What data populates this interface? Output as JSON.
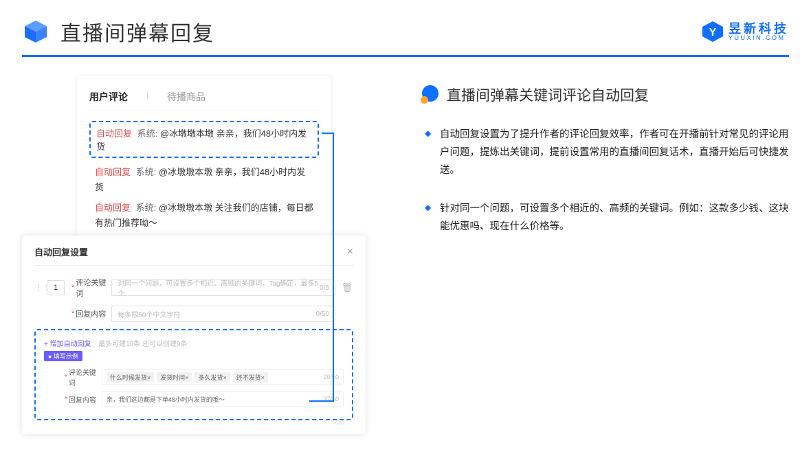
{
  "header": {
    "title": "直播间弹幕回复",
    "logo_cn": "昱新科技",
    "logo_en": "YUUXIN.COM"
  },
  "right": {
    "heading": "直播间弹幕关键词评论自动回复",
    "bullet1": "自动回复设置为了提升作者的评论回复效率，作者可在开播前针对常见的评论用户问题，提炼出关键词，提前设置常用的直播间回复话术，直播开始后可快捷发送。",
    "bullet2": "针对同一个问题，可设置多个相近的、高频的关键词。例如：这款多少钱、这块能优惠吗、现在什么价格等。"
  },
  "comments": {
    "tab1": "用户评论",
    "tab2": "待播商品",
    "auto_label": "自动回复",
    "sys_label": "系统:",
    "row1": "@冰墩墩本墩 亲亲，我们48小时内发货",
    "row2": "@冰墩墩本墩 亲亲，我们48小时内发货",
    "row3": "@冰墩墩本墩 关注我们的店铺，每日都有热门推荐呦～"
  },
  "settings": {
    "title": "自动回复设置",
    "num": "1",
    "label_kw": "评论关键词",
    "placeholder_kw": "对同一个问题，可设置多个相近、高频的关键词，Tag确定，最多5个",
    "count_kw": "0/5",
    "label_reply": "回复内容",
    "placeholder_reply": "每条限50个中文字符",
    "count_reply": "0/50",
    "add_link": "+ 增加自动回复",
    "add_note": "最多可建10条 还可以创建9条",
    "example_badge": "● 填写示例",
    "ex_label_kw": "评论关键词",
    "ex_tag1": "什么时候发货×",
    "ex_tag2": "发货时间×",
    "ex_tag3": "多久发货×",
    "ex_tag4": "还不发货×",
    "ex_count_kw": "20/50",
    "ex_label_reply": "回复内容",
    "ex_reply_value": "亲，我们这边都是下单48小时内发货的哦～",
    "ex_count_reply": "37/50",
    "peek": "/50"
  }
}
